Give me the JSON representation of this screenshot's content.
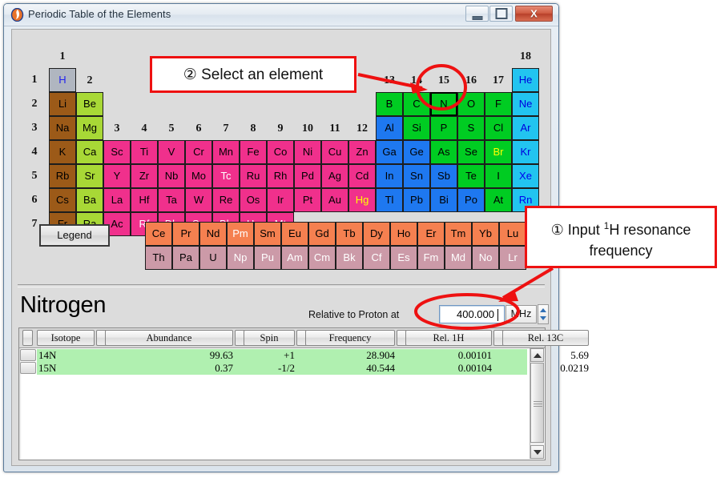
{
  "window": {
    "title": "Periodic Table of the Elements",
    "app_icon": "flame-icon",
    "minimize_label": "Minimize",
    "maximize_label": "Maximize",
    "close_label": "X"
  },
  "periodic_table": {
    "group_numbers": [
      "1",
      "2",
      "3",
      "4",
      "5",
      "6",
      "7",
      "8",
      "9",
      "10",
      "11",
      "12",
      "13",
      "14",
      "15",
      "16",
      "17",
      "18"
    ],
    "period_numbers": [
      "1",
      "2",
      "3",
      "4",
      "5",
      "6",
      "7"
    ],
    "legend_button": "Legend",
    "colors": {
      "hydrogen_bg": "#b0b6c0",
      "alkali_bg": "#9c5a18",
      "alkaline_bg": "#a8d836",
      "transition_bg": "#f0308c",
      "post_transition_bg": "#1e78f0",
      "nonmetal_bg": "#00cc22",
      "noble_bg": "#22c4f0",
      "lanthanide_bg": "#f58050",
      "actinide_bg": "#cc9aa8",
      "selected_outline": "#000000"
    },
    "elements": [
      {
        "sym": "H",
        "col": 1,
        "row": 1,
        "cls": "h"
      },
      {
        "sym": "He",
        "col": 18,
        "row": 1,
        "cls": "noble"
      },
      {
        "sym": "Li",
        "col": 1,
        "row": 2,
        "cls": "alkali"
      },
      {
        "sym": "Be",
        "col": 2,
        "row": 2,
        "cls": "alkaline"
      },
      {
        "sym": "B",
        "col": 13,
        "row": 2,
        "cls": "nonmetal"
      },
      {
        "sym": "C",
        "col": 14,
        "row": 2,
        "cls": "nonmetal"
      },
      {
        "sym": "N",
        "col": 15,
        "row": 2,
        "cls": "nonmetal",
        "selected": true
      },
      {
        "sym": "O",
        "col": 16,
        "row": 2,
        "cls": "nonmetal"
      },
      {
        "sym": "F",
        "col": 17,
        "row": 2,
        "cls": "nonmetal"
      },
      {
        "sym": "Ne",
        "col": 18,
        "row": 2,
        "cls": "noble"
      },
      {
        "sym": "Na",
        "col": 1,
        "row": 3,
        "cls": "alkali"
      },
      {
        "sym": "Mg",
        "col": 2,
        "row": 3,
        "cls": "alkaline"
      },
      {
        "sym": "Al",
        "col": 13,
        "row": 3,
        "cls": "post"
      },
      {
        "sym": "Si",
        "col": 14,
        "row": 3,
        "cls": "nonmetal"
      },
      {
        "sym": "P",
        "col": 15,
        "row": 3,
        "cls": "nonmetal"
      },
      {
        "sym": "S",
        "col": 16,
        "row": 3,
        "cls": "nonmetal"
      },
      {
        "sym": "Cl",
        "col": 17,
        "row": 3,
        "cls": "nonmetal"
      },
      {
        "sym": "Ar",
        "col": 18,
        "row": 3,
        "cls": "noble"
      },
      {
        "sym": "K",
        "col": 1,
        "row": 4,
        "cls": "alkali"
      },
      {
        "sym": "Ca",
        "col": 2,
        "row": 4,
        "cls": "alkaline"
      },
      {
        "sym": "Sc",
        "col": 3,
        "row": 4,
        "cls": "trans"
      },
      {
        "sym": "Ti",
        "col": 4,
        "row": 4,
        "cls": "trans"
      },
      {
        "sym": "V",
        "col": 5,
        "row": 4,
        "cls": "trans"
      },
      {
        "sym": "Cr",
        "col": 6,
        "row": 4,
        "cls": "trans"
      },
      {
        "sym": "Mn",
        "col": 7,
        "row": 4,
        "cls": "trans"
      },
      {
        "sym": "Fe",
        "col": 8,
        "row": 4,
        "cls": "trans"
      },
      {
        "sym": "Co",
        "col": 9,
        "row": 4,
        "cls": "trans"
      },
      {
        "sym": "Ni",
        "col": 10,
        "row": 4,
        "cls": "trans"
      },
      {
        "sym": "Cu",
        "col": 11,
        "row": 4,
        "cls": "trans"
      },
      {
        "sym": "Zn",
        "col": 12,
        "row": 4,
        "cls": "trans"
      },
      {
        "sym": "Ga",
        "col": 13,
        "row": 4,
        "cls": "post"
      },
      {
        "sym": "Ge",
        "col": 14,
        "row": 4,
        "cls": "post"
      },
      {
        "sym": "As",
        "col": 15,
        "row": 4,
        "cls": "nonmetal"
      },
      {
        "sym": "Se",
        "col": 16,
        "row": 4,
        "cls": "nonmetal"
      },
      {
        "sym": "Br",
        "col": 17,
        "row": 4,
        "cls": "nonmetal",
        "fg": "yellow"
      },
      {
        "sym": "Kr",
        "col": 18,
        "row": 4,
        "cls": "noble"
      },
      {
        "sym": "Rb",
        "col": 1,
        "row": 5,
        "cls": "alkali"
      },
      {
        "sym": "Sr",
        "col": 2,
        "row": 5,
        "cls": "alkaline"
      },
      {
        "sym": "Y",
        "col": 3,
        "row": 5,
        "cls": "trans"
      },
      {
        "sym": "Zr",
        "col": 4,
        "row": 5,
        "cls": "trans"
      },
      {
        "sym": "Nb",
        "col": 5,
        "row": 5,
        "cls": "trans"
      },
      {
        "sym": "Mo",
        "col": 6,
        "row": 5,
        "cls": "trans"
      },
      {
        "sym": "Tc",
        "col": 7,
        "row": 5,
        "cls": "trans",
        "fg": "white"
      },
      {
        "sym": "Ru",
        "col": 8,
        "row": 5,
        "cls": "trans"
      },
      {
        "sym": "Rh",
        "col": 9,
        "row": 5,
        "cls": "trans"
      },
      {
        "sym": "Pd",
        "col": 10,
        "row": 5,
        "cls": "trans"
      },
      {
        "sym": "Ag",
        "col": 11,
        "row": 5,
        "cls": "trans"
      },
      {
        "sym": "Cd",
        "col": 12,
        "row": 5,
        "cls": "trans"
      },
      {
        "sym": "In",
        "col": 13,
        "row": 5,
        "cls": "post"
      },
      {
        "sym": "Sn",
        "col": 14,
        "row": 5,
        "cls": "post"
      },
      {
        "sym": "Sb",
        "col": 15,
        "row": 5,
        "cls": "post"
      },
      {
        "sym": "Te",
        "col": 16,
        "row": 5,
        "cls": "nonmetal"
      },
      {
        "sym": "I",
        "col": 17,
        "row": 5,
        "cls": "nonmetal"
      },
      {
        "sym": "Xe",
        "col": 18,
        "row": 5,
        "cls": "noble",
        "fg": "blue"
      },
      {
        "sym": "Cs",
        "col": 1,
        "row": 6,
        "cls": "alkali"
      },
      {
        "sym": "Ba",
        "col": 2,
        "row": 6,
        "cls": "alkaline"
      },
      {
        "sym": "La",
        "col": 3,
        "row": 6,
        "cls": "trans"
      },
      {
        "sym": "Hf",
        "col": 4,
        "row": 6,
        "cls": "trans"
      },
      {
        "sym": "Ta",
        "col": 5,
        "row": 6,
        "cls": "trans"
      },
      {
        "sym": "W",
        "col": 6,
        "row": 6,
        "cls": "trans"
      },
      {
        "sym": "Re",
        "col": 7,
        "row": 6,
        "cls": "trans"
      },
      {
        "sym": "Os",
        "col": 8,
        "row": 6,
        "cls": "trans"
      },
      {
        "sym": "Ir",
        "col": 9,
        "row": 6,
        "cls": "trans"
      },
      {
        "sym": "Pt",
        "col": 10,
        "row": 6,
        "cls": "trans"
      },
      {
        "sym": "Au",
        "col": 11,
        "row": 6,
        "cls": "trans"
      },
      {
        "sym": "Hg",
        "col": 12,
        "row": 6,
        "cls": "trans",
        "fg": "yellow"
      },
      {
        "sym": "Tl",
        "col": 13,
        "row": 6,
        "cls": "post"
      },
      {
        "sym": "Pb",
        "col": 14,
        "row": 6,
        "cls": "post"
      },
      {
        "sym": "Bi",
        "col": 15,
        "row": 6,
        "cls": "post"
      },
      {
        "sym": "Po",
        "col": 16,
        "row": 6,
        "cls": "post"
      },
      {
        "sym": "At",
        "col": 17,
        "row": 6,
        "cls": "nonmetal"
      },
      {
        "sym": "Rn",
        "col": 18,
        "row": 6,
        "cls": "noble",
        "fg": "blue"
      },
      {
        "sym": "Fr",
        "col": 1,
        "row": 7,
        "cls": "alkali"
      },
      {
        "sym": "Ra",
        "col": 2,
        "row": 7,
        "cls": "alkaline"
      },
      {
        "sym": "Ac",
        "col": 3,
        "row": 7,
        "cls": "trans"
      },
      {
        "sym": "Rf",
        "col": 4,
        "row": 7,
        "cls": "trans",
        "fg": "white"
      },
      {
        "sym": "Db",
        "col": 5,
        "row": 7,
        "cls": "trans",
        "fg": "white"
      },
      {
        "sym": "Sg",
        "col": 6,
        "row": 7,
        "cls": "trans",
        "fg": "white"
      },
      {
        "sym": "Bh",
        "col": 7,
        "row": 7,
        "cls": "trans",
        "fg": "white"
      },
      {
        "sym": "Hs",
        "col": 8,
        "row": 7,
        "cls": "trans",
        "fg": "white"
      },
      {
        "sym": "Mt",
        "col": 9,
        "row": 7,
        "cls": "trans",
        "fg": "white"
      }
    ],
    "lanthanides": [
      {
        "sym": "Ce"
      },
      {
        "sym": "Pr"
      },
      {
        "sym": "Nd"
      },
      {
        "sym": "Pm",
        "fg": "white"
      },
      {
        "sym": "Sm"
      },
      {
        "sym": "Eu"
      },
      {
        "sym": "Gd"
      },
      {
        "sym": "Tb"
      },
      {
        "sym": "Dy"
      },
      {
        "sym": "Ho"
      },
      {
        "sym": "Er"
      },
      {
        "sym": "Tm"
      },
      {
        "sym": "Yb"
      },
      {
        "sym": "Lu"
      }
    ],
    "actinides": [
      {
        "sym": "Th"
      },
      {
        "sym": "Pa"
      },
      {
        "sym": "U"
      },
      {
        "sym": "Np",
        "fg": "white"
      },
      {
        "sym": "Pu",
        "fg": "white"
      },
      {
        "sym": "Am",
        "fg": "white"
      },
      {
        "sym": "Cm",
        "fg": "white"
      },
      {
        "sym": "Bk",
        "fg": "white"
      },
      {
        "sym": "Cf",
        "fg": "white"
      },
      {
        "sym": "Es",
        "fg": "white"
      },
      {
        "sym": "Fm",
        "fg": "white"
      },
      {
        "sym": "Md",
        "fg": "white"
      },
      {
        "sym": "No",
        "fg": "white"
      },
      {
        "sym": "Lr",
        "fg": "white"
      }
    ]
  },
  "detail": {
    "element_name": "Nitrogen",
    "relative_label": "Relative to Proton at",
    "frequency_value": "400.000",
    "unit": "MHz",
    "columns": [
      "Isotope",
      "Abundance",
      "Spin",
      "Frequency",
      "Rel. 1H",
      "Rel. 13C"
    ],
    "rows": [
      {
        "isotope": "14N",
        "abundance": "99.63",
        "spin": "+1",
        "frequency": "28.904",
        "rel_1h": "0.00101",
        "rel_13c": "5.69"
      },
      {
        "isotope": "15N",
        "abundance": "0.37",
        "spin": "-1/2",
        "frequency": "40.544",
        "rel_1h": "0.00104",
        "rel_13c": "0.0219"
      }
    ]
  },
  "annotations": {
    "step1_prefix": "① Input ",
    "step1_sup": "1",
    "step1_suffix": "H resonance",
    "step1_line2": "frequency",
    "step2": "② Select an element",
    "accent_color": "#ee1111"
  }
}
